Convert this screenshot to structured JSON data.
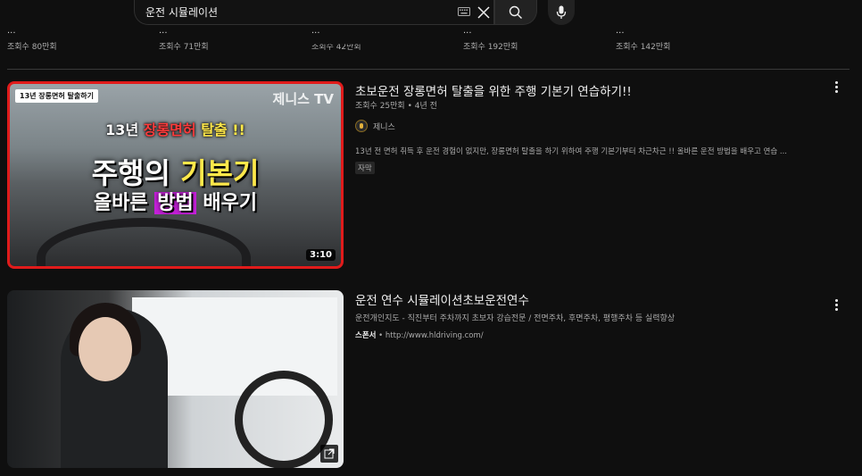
{
  "search": {
    "query": "운전 시뮬레이션"
  },
  "shelf": [
    {
      "title": "...",
      "views": "조회수 80만회"
    },
    {
      "title": "...",
      "views": "조회수 71만회"
    },
    {
      "title": "...",
      "views": "조회수 42만회"
    },
    {
      "title": "...",
      "views": "조회수 192만회"
    },
    {
      "title": "...",
      "views": "조회수 142만회"
    }
  ],
  "results": [
    {
      "title": "초보운전 장롱면허 탈출을 위한 주행 기본기 연습하기!!",
      "meta": "조회수 25만회 • 4년 전",
      "channel": "제니스",
      "description": "13년 전 면허 취득 후 운전 경험이 없지만, 장롱면허 탈출을 하기 위하여 주행 기본기부터 차근차근 !! 올바른 운전 방법을 배우고 연습 ...",
      "badge": "자막",
      "duration": "3:10",
      "thumb": {
        "tag": "13년 장롱면허 탈출하기",
        "brand": "제니스 TV",
        "line1_a": "13년 ",
        "line1_b": "장롱면허",
        "line1_c": " 탈출 !!",
        "line2_a": "주행의 ",
        "line2_b": "기본기",
        "line3_a": "올바른 ",
        "line3_b": "방법",
        "line3_c": " 배우기"
      }
    },
    {
      "title": "운전 연수 시뮬레이션초보운전연수",
      "description": "운전개인지도 - 직진부터 주차까지 초보자 강습전문 / 전면주차, 후면주차, 평행주차 등 실력향상",
      "sponsor_label": "스폰서",
      "sponsor_url": " • http://www.hldriving.com/"
    }
  ],
  "colors": {
    "accent_red": "#e01b1b",
    "highlight_yellow": "#ffe84a",
    "highlight_purple": "#c41fd8"
  }
}
